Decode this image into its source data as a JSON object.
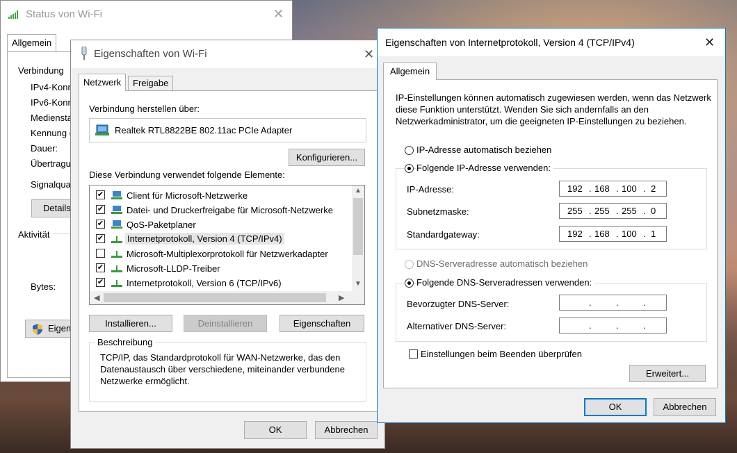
{
  "status_window": {
    "title": "Status von Wi-Fi",
    "tab": "Allgemein",
    "section_connection": "Verbindung",
    "rows": [
      "IPv4-Konn",
      "IPv6-Konn",
      "Mediensta",
      "Kennung (",
      "Dauer:",
      "Übertragu"
    ],
    "signal_label": "Signalqual",
    "details_button": "Details",
    "section_activity": "Aktivität",
    "bytes_label": "Bytes:",
    "properties_button": "Eigens",
    "accent": "#0078d7"
  },
  "props_window": {
    "title": "Eigenschaften von Wi-Fi",
    "tabs": [
      "Netzwerk",
      "Freigabe"
    ],
    "connect_via_label": "Verbindung herstellen über:",
    "adapter": "Realtek RTL8822BE 802.11ac PCIe Adapter",
    "configure_button": "Konfigurieren...",
    "items_label": "Diese Verbindung verwendet folgende Elemente:",
    "items": [
      {
        "label": "Client für Microsoft-Netzwerke",
        "checked": true,
        "icon": "network-client-icon"
      },
      {
        "label": "Datei- und Druckerfreigabe für Microsoft-Netzwerke",
        "checked": true,
        "icon": "network-service-icon"
      },
      {
        "label": "QoS-Paketplaner",
        "checked": true,
        "icon": "network-service-icon"
      },
      {
        "label": "Internetprotokoll, Version 4 (TCP/IPv4)",
        "checked": true,
        "icon": "protocol-icon",
        "selected": true
      },
      {
        "label": "Microsoft-Multiplexorprotokoll für Netzwerkadapter",
        "checked": false,
        "icon": "protocol-icon"
      },
      {
        "label": "Microsoft-LLDP-Treiber",
        "checked": true,
        "icon": "protocol-icon"
      },
      {
        "label": "Internetprotokoll, Version 6 (TCP/IPv6)",
        "checked": true,
        "icon": "protocol-icon"
      }
    ],
    "install_button": "Installieren...",
    "uninstall_button": "Deinstallieren",
    "properties_button": "Eigenschaften",
    "description_title": "Beschreibung",
    "description_text": "TCP/IP, das Standardprotokoll für WAN-Netzwerke, das den Datenaustausch über verschiedene, miteinander verbundene Netzwerke ermöglicht.",
    "ok_button": "OK",
    "cancel_button": "Abbrechen"
  },
  "ipv4_window": {
    "title": "Eigenschaften von Internetprotokoll, Version 4 (TCP/IPv4)",
    "tab": "Allgemein",
    "intro": "IP-Einstellungen können automatisch zugewiesen werden, wenn das Netzwerk diese Funktion unterstützt. Wenden Sie sich andernfalls an den Netzwerkadministrator, um die geeigneten IP-Einstellungen zu beziehen.",
    "radio_auto_ip": "IP-Adresse automatisch beziehen",
    "radio_manual_ip": "Folgende IP-Adresse verwenden:",
    "ip_label": "IP-Adresse:",
    "ip_value": [
      "192",
      "168",
      "100",
      "2"
    ],
    "subnet_label": "Subnetzmaske:",
    "subnet_value": [
      "255",
      "255",
      "255",
      "0"
    ],
    "gateway_label": "Standardgateway:",
    "gateway_value": [
      "192",
      "168",
      "100",
      "1"
    ],
    "radio_auto_dns": "DNS-Serveradresse automatisch beziehen",
    "radio_manual_dns": "Folgende DNS-Serveradressen verwenden:",
    "preferred_dns_label": "Bevorzugter DNS-Server:",
    "alternate_dns_label": "Alternativer DNS-Server:",
    "validate_checkbox": "Einstellungen beim Beenden überprüfen",
    "advanced_button": "Erweitert...",
    "ok_button": "OK",
    "cancel_button": "Abbrechen"
  }
}
